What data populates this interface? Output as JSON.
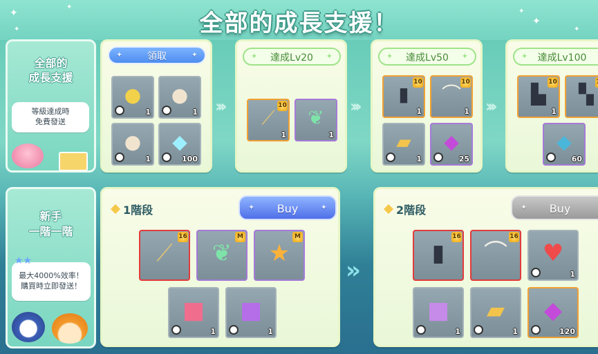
{
  "page": {
    "title": "全部的成長支援！"
  },
  "growth": {
    "side_title_line1": "全部的",
    "side_title_line2": "成長支援",
    "bubble_line1": "等級達成時",
    "bubble_line2": "免費發送",
    "claim_label": "領取",
    "milestones": [
      {
        "label": "達成Lv20"
      },
      {
        "label": "達成Lv50"
      },
      {
        "label": "達成Lv100"
      }
    ],
    "claim_items": [
      {
        "icon": "purple-sprout-icon",
        "qty": "1"
      },
      {
        "icon": "white-sprout-icon",
        "qty": "1"
      },
      {
        "icon": "red-flower-sprout-icon",
        "qty": "1"
      },
      {
        "icon": "crystal-stump-icon",
        "qty": "100"
      }
    ],
    "lv20_items": [
      {
        "icon": "staff-weapon-icon",
        "badge": "10",
        "qty": "1"
      },
      {
        "icon": "green-leaf-icon",
        "qty": "1"
      }
    ],
    "lv50_items": [
      {
        "icon": "dark-armor-icon",
        "badge": "10",
        "qty": "1"
      },
      {
        "icon": "winged-cape-icon",
        "badge": "10",
        "qty": "1"
      },
      {
        "icon": "gold-ticket-icon",
        "qty": "1"
      },
      {
        "icon": "gem-pouch-icon",
        "qty": "25"
      }
    ],
    "lv100_items": [
      {
        "icon": "armored-boot-icon",
        "badge": "10",
        "qty": "1"
      },
      {
        "icon": "armored-glove-icon",
        "badge": "10"
      },
      {
        "icon": "blue-gem-pouch-icon",
        "qty": "60"
      }
    ]
  },
  "novice": {
    "side_title_line1": "新手",
    "side_title_line2": "一階一階",
    "bubble_line1": "最大4000%效率！",
    "bubble_line2": "購買時立即發送！",
    "tiers": [
      {
        "label": "1階段",
        "buy": "Buy"
      },
      {
        "label": "2階段",
        "buy": "Buy"
      }
    ],
    "tier1_items": [
      {
        "icon": "staff-weapon-icon",
        "badge": "16"
      },
      {
        "icon": "green-leaf-icon",
        "badge": "M"
      },
      {
        "icon": "star-ring-icon",
        "badge": "M"
      },
      {
        "icon": "gift-box-icon",
        "qty": "1"
      },
      {
        "icon": "lucky-box-icon",
        "qty": "1"
      }
    ],
    "tier2_items": [
      {
        "icon": "dark-armor-icon",
        "badge": "16"
      },
      {
        "icon": "winged-cape-icon",
        "badge": "16"
      },
      {
        "icon": "potion-icon",
        "qty": "1"
      },
      {
        "icon": "purple-gift-icon",
        "qty": "1"
      },
      {
        "icon": "gold-ticket-icon",
        "qty": "1"
      },
      {
        "icon": "gem-pouch-icon",
        "qty": "120"
      }
    ]
  }
}
